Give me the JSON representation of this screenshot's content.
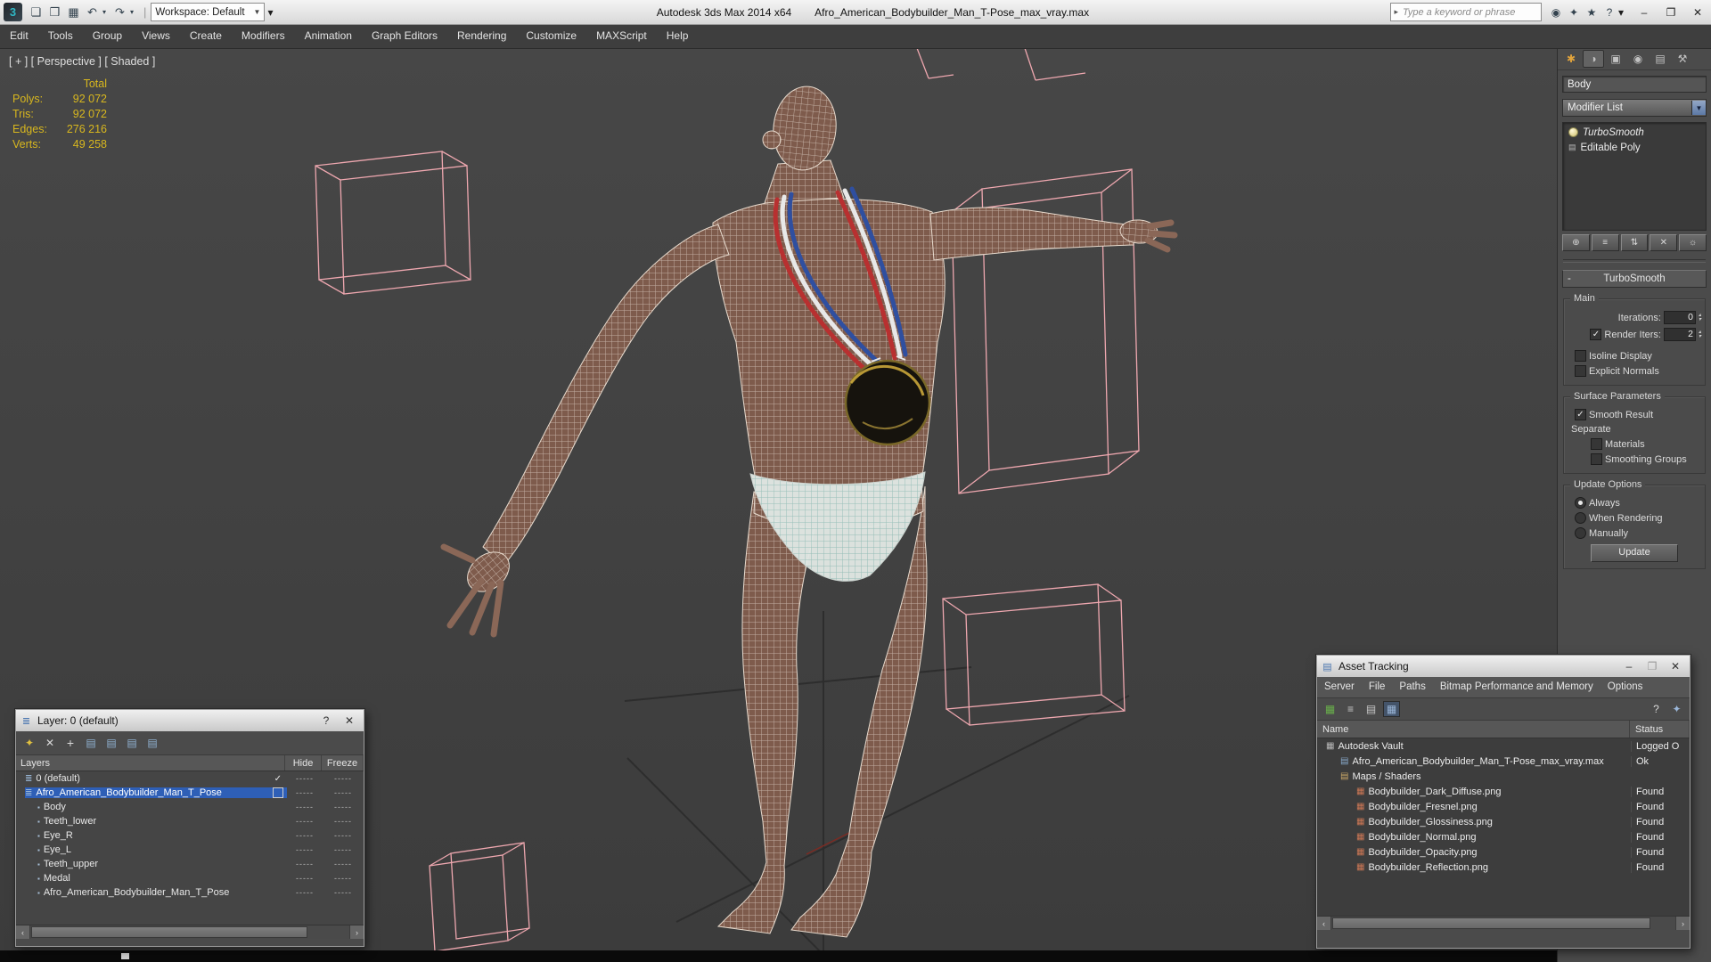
{
  "titlebar": {
    "app_title": "Autodesk 3ds Max 2014 x64",
    "file_title": "Afro_American_Bodybuilder_Man_T-Pose_max_vray.max",
    "workspace": "Workspace: Default",
    "search_placeholder": "Type a keyword or phrase"
  },
  "menubar": {
    "items": [
      "Edit",
      "Tools",
      "Group",
      "Views",
      "Create",
      "Modifiers",
      "Animation",
      "Graph Editors",
      "Rendering",
      "Customize",
      "MAXScript",
      "Help"
    ]
  },
  "viewport": {
    "label": "[ + ] [ Perspective ] [ Shaded ]",
    "stats": {
      "total_label": "Total",
      "rows": [
        {
          "label": "Polys:",
          "value": "92 072"
        },
        {
          "label": "Tris:",
          "value": "92 072"
        },
        {
          "label": "Edges:",
          "value": "276 216"
        },
        {
          "label": "Verts:",
          "value": "49 258"
        }
      ]
    }
  },
  "command_panel": {
    "object_name": "Body",
    "modifier_list": "Modifier List",
    "stack": {
      "turbosmooth": "TurboSmooth",
      "editable_poly": "Editable Poly"
    },
    "turbosmooth": {
      "title": "TurboSmooth",
      "main_label": "Main",
      "iterations_label": "Iterations:",
      "iterations_value": "0",
      "render_iters_label": "Render Iters:",
      "render_iters_value": "2",
      "isoline_display": "Isoline Display",
      "explicit_normals": "Explicit Normals",
      "surface_parameters_label": "Surface Parameters",
      "smooth_result": "Smooth Result",
      "separate_label": "Separate",
      "materials": "Materials",
      "smoothing_groups": "Smoothing Groups",
      "update_options_label": "Update Options",
      "always": "Always",
      "when_rendering": "When Rendering",
      "manually": "Manually",
      "update_button": "Update"
    },
    "states": {
      "render_iters": true,
      "smooth_result": true,
      "isoline_display": false,
      "explicit_normals": false,
      "materials": false,
      "smoothing_groups": false,
      "mode_always": true,
      "mode_when_rendering": false,
      "mode_manually": false
    }
  },
  "layer_dialog": {
    "title": "Layer: 0 (default)",
    "columns": [
      "Layers",
      "Hide",
      "Freeze"
    ],
    "dash": "-----",
    "rows": [
      {
        "label": "0 (default)"
      },
      {
        "label": "Afro_American_Bodybuilder_Man_T_Pose"
      },
      {
        "label": "Body"
      },
      {
        "label": "Teeth_lower"
      },
      {
        "label": "Eye_R"
      },
      {
        "label": "Eye_L"
      },
      {
        "label": "Teeth_upper"
      },
      {
        "label": "Medal"
      },
      {
        "label": "Afro_American_Bodybuilder_Man_T_Pose"
      }
    ]
  },
  "asset_tracking": {
    "title": "Asset Tracking",
    "menu": [
      "Server",
      "File",
      "Paths",
      "Bitmap Performance and Memory",
      "Options"
    ],
    "columns": [
      "Name",
      "Status"
    ],
    "rows": [
      {
        "name": "Autodesk Vault",
        "status": "Logged O"
      },
      {
        "name": "Afro_American_Bodybuilder_Man_T-Pose_max_vray.max",
        "status": "Ok"
      },
      {
        "name": "Maps / Shaders",
        "status": ""
      },
      {
        "name": "Bodybuilder_Dark_Diffuse.png",
        "status": "Found"
      },
      {
        "name": "Bodybuilder_Fresnel.png",
        "status": "Found"
      },
      {
        "name": "Bodybuilder_Glossiness.png",
        "status": "Found"
      },
      {
        "name": "Bodybuilder_Normal.png",
        "status": "Found"
      },
      {
        "name": "Bodybuilder_Opacity.png",
        "status": "Found"
      },
      {
        "name": "Bodybuilder_Reflection.png",
        "status": "Found"
      }
    ]
  },
  "icons": {
    "app": "3",
    "new_scene": "❏",
    "open_file": "❒",
    "save_file": "▦",
    "undo": "↶",
    "redo": "↷",
    "dropdown": "▾",
    "combo_arrow": "▼",
    "separator": "|",
    "search_go": "▸",
    "find": "◉",
    "community": "✦",
    "favorites": "★",
    "help": "?",
    "minimize": "–",
    "maximize": "❐",
    "close": "✕",
    "tab_create": "✱",
    "tab_modify": "◑",
    "tab_hierarchy": "▣",
    "tab_motion": "◉",
    "tab_display": "▤",
    "tab_utilities": "⚒",
    "stack_pin": "⊕",
    "stack_show_end": "≡",
    "stack_unique": "⇅",
    "stack_remove": "✕",
    "stack_configure": "☼",
    "poly": "▤",
    "collapse_minus": "-",
    "check": "✓",
    "scroll_left": "‹",
    "scroll_right": "›",
    "layer_new": "✦",
    "layer_delete": "✕",
    "layer_add": "+",
    "layer_generic": "▤",
    "dlg_layers": "≣",
    "dlg_asset": "▤",
    "vault": "▦",
    "max_file": "▤",
    "maps": "▤",
    "png": "▦",
    "at_tool_green": "▦",
    "at_tool_list": "≡",
    "at_tool_table": "▤",
    "at_tool_grid": "▦",
    "at_help": "?",
    "at_link": "✦"
  }
}
